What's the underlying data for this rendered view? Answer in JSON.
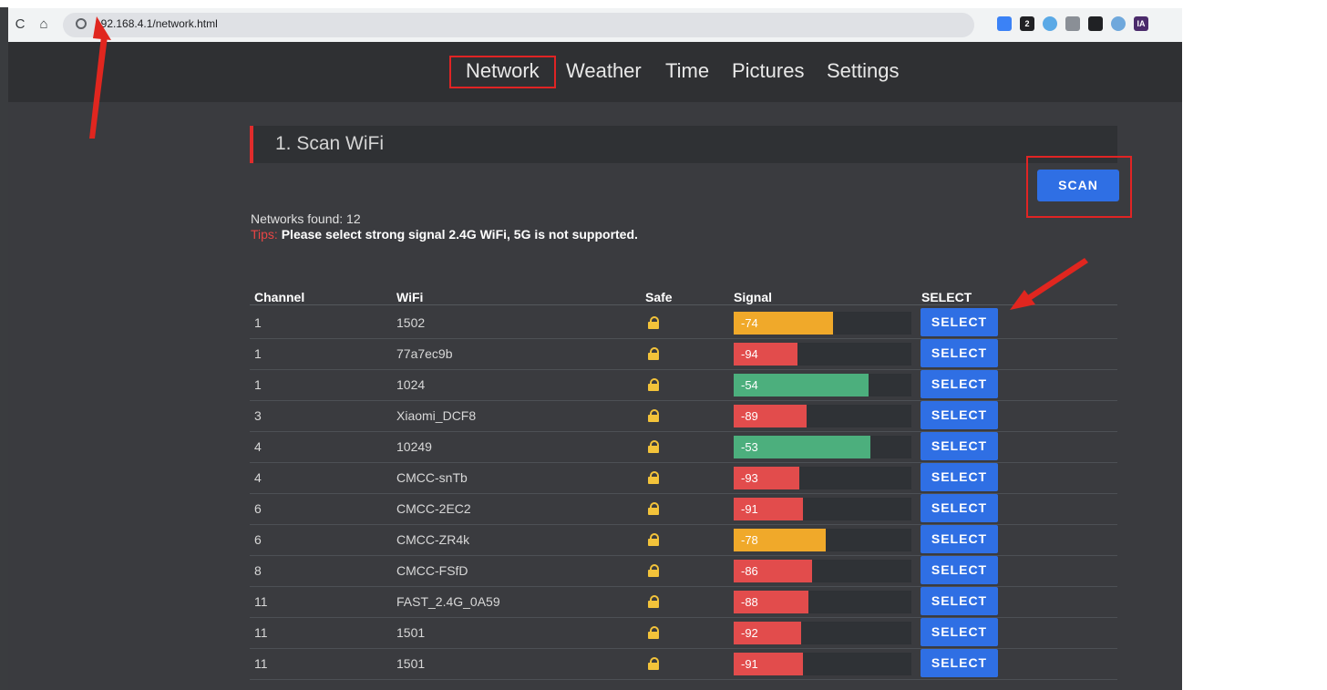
{
  "browser": {
    "url": "192.168.4.1/network.html",
    "back_glyph": "C",
    "home_glyph": "⌂",
    "extensions": [
      {
        "name": "ext-1",
        "color": "#3b82f6",
        "text": ""
      },
      {
        "name": "ext-2",
        "color": "#202124",
        "text": "2"
      },
      {
        "name": "ext-3",
        "color": "#5aa9e6",
        "text": ""
      },
      {
        "name": "ext-4",
        "color": "#8a8f96",
        "text": ""
      },
      {
        "name": "ext-5",
        "color": "#202124",
        "text": ""
      },
      {
        "name": "ext-6",
        "color": "#6fa8dc",
        "text": ""
      },
      {
        "name": "ext-7",
        "color": "#4b2b6b",
        "text": "IA"
      }
    ]
  },
  "nav": {
    "items": [
      {
        "label": "Network",
        "active": true
      },
      {
        "label": "Weather"
      },
      {
        "label": "Time"
      },
      {
        "label": "Pictures"
      },
      {
        "label": "Settings"
      }
    ]
  },
  "section": {
    "title": "1. Scan WiFi",
    "scan_label": "SCAN",
    "found_text": "Networks found: 12",
    "tips_label": "Tips:",
    "tips_text": " Please select strong signal 2.4G WiFi, 5G is not supported."
  },
  "table": {
    "headers": {
      "channel": "Channel",
      "wifi": "WiFi",
      "safe": "Safe",
      "signal": "Signal",
      "select": "SELECT"
    },
    "select_label": "SELECT",
    "rows": [
      {
        "channel": "1",
        "wifi": "1502",
        "signal": "-74",
        "level": 0.56,
        "color": "#f0a92a"
      },
      {
        "channel": "1",
        "wifi": "77a7ec9b",
        "signal": "-94",
        "level": 0.36,
        "color": "#e24c4c"
      },
      {
        "channel": "1",
        "wifi": "1024",
        "signal": "-54",
        "level": 0.76,
        "color": "#4caf7d"
      },
      {
        "channel": "3",
        "wifi": "Xiaomi_DCF8",
        "signal": "-89",
        "level": 0.41,
        "color": "#e24c4c"
      },
      {
        "channel": "4",
        "wifi": "10249",
        "signal": "-53",
        "level": 0.77,
        "color": "#4caf7d"
      },
      {
        "channel": "4",
        "wifi": "CMCC-snTb",
        "signal": "-93",
        "level": 0.37,
        "color": "#e24c4c"
      },
      {
        "channel": "6",
        "wifi": "CMCC-2EC2",
        "signal": "-91",
        "level": 0.39,
        "color": "#e24c4c"
      },
      {
        "channel": "6",
        "wifi": "CMCC-ZR4k",
        "signal": "-78",
        "level": 0.52,
        "color": "#f0a92a"
      },
      {
        "channel": "8",
        "wifi": "CMCC-FSfD",
        "signal": "-86",
        "level": 0.44,
        "color": "#e24c4c"
      },
      {
        "channel": "11",
        "wifi": "FAST_2.4G_0A59",
        "signal": "-88",
        "level": 0.42,
        "color": "#e24c4c"
      },
      {
        "channel": "11",
        "wifi": "1501",
        "signal": "-92",
        "level": 0.38,
        "color": "#e24c4c"
      },
      {
        "channel": "11",
        "wifi": "1501",
        "signal": "-91",
        "level": 0.39,
        "color": "#e24c4c"
      }
    ]
  },
  "colors": {
    "accent": "#2f6fe4",
    "highlight": "#e02424"
  }
}
